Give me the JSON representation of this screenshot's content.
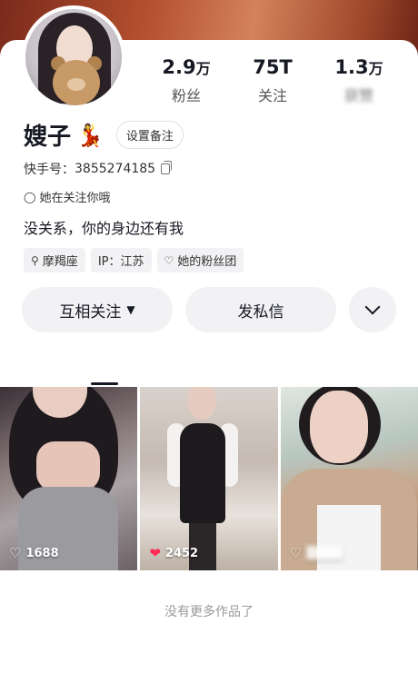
{
  "profile": {
    "name": "嫂子",
    "name_emoji": "💃",
    "remark_button": "设置备注",
    "uid_label": "快手号：",
    "uid_value": "3855274185",
    "follows_status": "她在关注你哦",
    "bio": "没关系，你的身边还有我"
  },
  "stats": [
    {
      "value": "2.9",
      "unit": "万",
      "label": "粉丝"
    },
    {
      "value": "75T",
      "unit": "",
      "label": "关注"
    },
    {
      "value": "1.3",
      "unit": "万",
      "label": "获赞"
    }
  ],
  "tags": [
    {
      "icon": "zodiac-icon",
      "label": "摩羯座"
    },
    {
      "icon": "location-icon",
      "label": "IP：江苏"
    },
    {
      "icon": "fan-group-icon",
      "label": "她的粉丝团"
    }
  ],
  "actions": {
    "follow": "互相关注",
    "message": "发私信",
    "more_icon": "chevron-down-icon"
  },
  "videos": [
    {
      "likes": "1688",
      "liked": false
    },
    {
      "likes": "2452",
      "liked": true
    },
    {
      "likes": "",
      "liked": false
    }
  ],
  "footer": {
    "no_more": "没有更多作品了"
  },
  "colors": {
    "like_red": "#fe2c55",
    "text_primary": "#161823",
    "button_bg": "#f2f2f4"
  }
}
